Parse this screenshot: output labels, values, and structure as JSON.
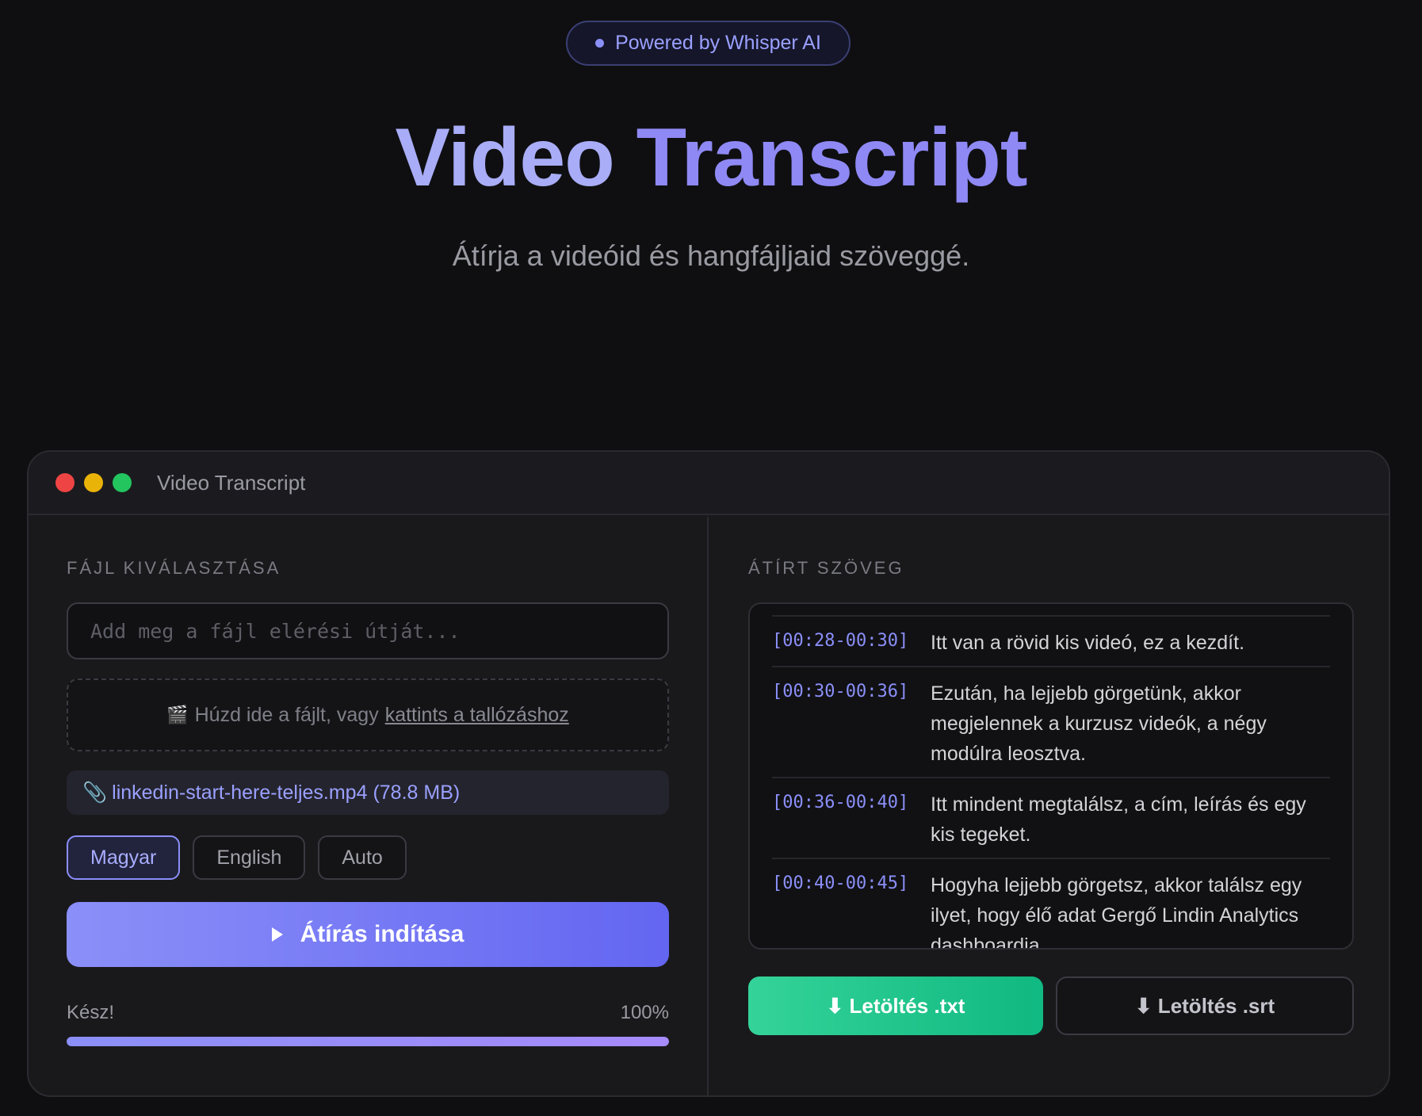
{
  "hero": {
    "badge": "Powered by Whisper AI",
    "title_part1": "Video",
    "title_part2": "Transcript",
    "subtitle": "Átírja a videóid és hangfájljaid szöveggé."
  },
  "window": {
    "title": "Video Transcript"
  },
  "left_panel": {
    "section_label": "FÁJL KIVÁLASZTÁSA",
    "path_input": {
      "placeholder": "Add meg a fájl elérési útját...",
      "value": ""
    },
    "dropzone": {
      "icon": "🎬",
      "text": "Húzd ide a fájlt, vagy",
      "link": "kattints a tallózáshoz"
    },
    "selected_file": {
      "icon": "📎",
      "text": "linkedin-start-here-teljes.mp4 (78.8 MB)"
    },
    "languages": [
      {
        "label": "Magyar",
        "active": true
      },
      {
        "label": "English",
        "active": false
      },
      {
        "label": "Auto",
        "active": false
      }
    ],
    "start_button": "Átírás indítása",
    "progress": {
      "label": "Kész!",
      "percent_text": "100%",
      "value": 100
    }
  },
  "right_panel": {
    "section_label": "ÁTÍRT SZÖVEG",
    "segments": [
      {
        "ts": "[00:28-00:30]",
        "text": "Itt van a rövid kis videó, ez a kezdít."
      },
      {
        "ts": "[00:30-00:36]",
        "text": "Ezután, ha lejjebb görgetünk, akkor megjelennek a kurzusz videók, a négy modúlra leosztva."
      },
      {
        "ts": "[00:36-00:40]",
        "text": "Itt mindent megtalálsz, a cím, leírás és egy kis tegeket."
      },
      {
        "ts": "[00:40-00:45]",
        "text": "Hogyha lejjebb görgetsz, akkor találsz egy ilyet, hogy élő adat Gergő Lindin Analytics dashboardja."
      }
    ],
    "download_txt": "⬇ Letöltés .txt",
    "download_srt": "⬇ Letöltés .srt"
  },
  "colors": {
    "accent": "#8b8ff8",
    "success": "#10b981",
    "background": "#0f0f12"
  }
}
